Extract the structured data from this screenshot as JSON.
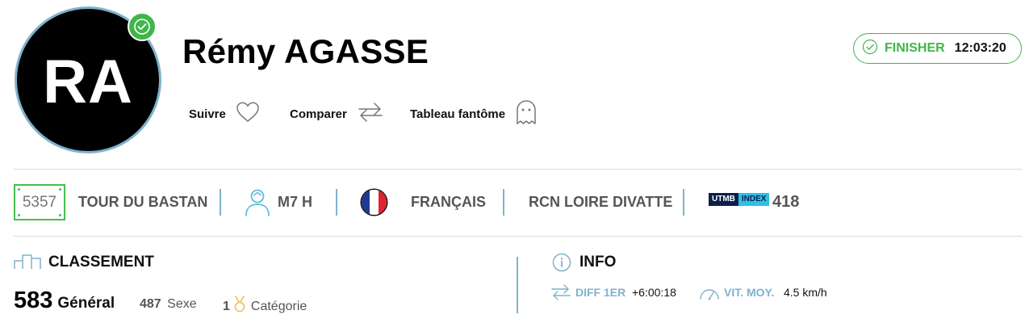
{
  "runner": {
    "initials": "RA",
    "name": "Rémy AGASSE"
  },
  "actions": {
    "follow": "Suivre",
    "compare": "Comparer",
    "ghost_table": "Tableau fantôme"
  },
  "status": {
    "label": "FINISHER",
    "time": "12:03:20",
    "color": "#3fb64a"
  },
  "info_bar": {
    "bib": "5357",
    "race": "TOUR DU BASTAN",
    "category": "M7 H",
    "nationality": "FRANÇAIS",
    "club": "RCN LOIRE DIVATTE",
    "utmb_logo_left": "UTMB",
    "utmb_logo_right": "INDEX",
    "utmb_index": "418"
  },
  "ranking": {
    "title": "CLASSEMENT",
    "general_value": "583",
    "general_label": "Général",
    "sex_value": "487",
    "sex_label": "Sexe",
    "category_value": "1",
    "category_label": "Catégorie"
  },
  "info": {
    "title": "INFO",
    "diff_label": "DIFF 1ER",
    "diff_value": "+6:00:18",
    "speed_label": "VIT. MOY.",
    "speed_value": "4.5 km/h"
  },
  "colors": {
    "accent_green": "#3fb64a",
    "accent_blue": "#7fb2cc",
    "utmb_navy": "#0c1f4a",
    "utmb_cyan": "#2cc0e6"
  }
}
